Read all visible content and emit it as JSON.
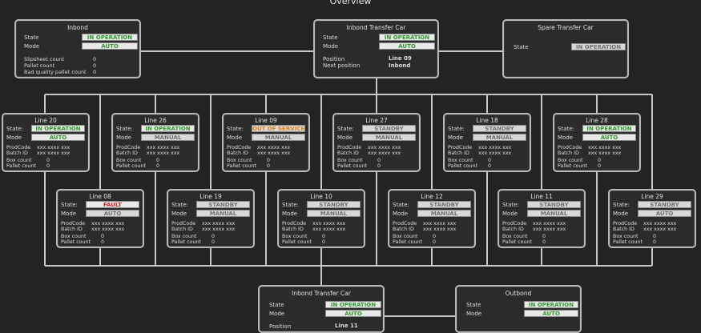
{
  "page_title": "Overview",
  "labels": {
    "state": "State",
    "state_colon": "State:",
    "mode": "Mode",
    "prodcode": "ProdCode",
    "batch_id": "Batch ID",
    "box_count": "Box count",
    "pallet_count": "Pallet count",
    "position": "Position",
    "next_position": "Next position",
    "slipsheet_count": "Slipsheet count",
    "bad_quality_pallet_count": "Bad quality pallet count"
  },
  "inbond": {
    "title": "Inbond",
    "state": "IN OPERATION",
    "mode": "AUTO",
    "slipsheet_count": "0",
    "pallet_count": "0",
    "bad_quality_pallet_count": "0"
  },
  "inbond_transfer_car_top": {
    "title": "Inbond Transfer Car",
    "state": "IN OPERATION",
    "mode": "AUTO",
    "position": "Line 09",
    "next_position": "Inbond"
  },
  "spare_transfer_car": {
    "title": "Spare Transfer Car",
    "state": "IN OPERATION"
  },
  "lines_row1": [
    {
      "title": "Line 20",
      "state": "IN OPERATION",
      "state_kind": "op",
      "mode": "AUTO",
      "mode_kind": "auto",
      "prodcode": "xxx xxxx xxx",
      "batch_id": "xxx xxxx xxx",
      "box_count": "0",
      "pallet_count": "0"
    },
    {
      "title": "Line 26",
      "state": "IN OPERATION",
      "state_kind": "op",
      "mode": "MANUAL",
      "mode_kind": "man",
      "prodcode": "xxx xxxx xxx",
      "batch_id": "xxx xxxx xxx",
      "box_count": "0",
      "pallet_count": "0"
    },
    {
      "title": "Line 09",
      "state": "OUT OF SERVICE",
      "state_kind": "oos",
      "mode": "MANUAL",
      "mode_kind": "man",
      "prodcode": "xxx xxxx xxx",
      "batch_id": "xxx xxxx xxx",
      "box_count": "0",
      "pallet_count": "0"
    },
    {
      "title": "Line 27",
      "state": "STANDBY",
      "state_kind": "stby",
      "mode": "MANUAL",
      "mode_kind": "man",
      "prodcode": "xxx xxxx xxx",
      "batch_id": "xxx xxxx xxx",
      "box_count": "0",
      "pallet_count": "0"
    },
    {
      "title": "Line 18",
      "state": "STANDBY",
      "state_kind": "stby",
      "mode": "MANUAL",
      "mode_kind": "man",
      "prodcode": "xxx xxxx xxx",
      "batch_id": "xxx xxxx xxx",
      "box_count": "0",
      "pallet_count": "0"
    },
    {
      "title": "Line 28",
      "state": "IN OPERATION",
      "state_kind": "op",
      "mode": "AUTO",
      "mode_kind": "auto",
      "prodcode": "xxx xxxx xxx",
      "batch_id": "xxx xxxx xxx",
      "box_count": "0",
      "pallet_count": "0"
    }
  ],
  "lines_row2": [
    {
      "title": "Line 08",
      "state": "FAULT",
      "state_kind": "fault",
      "mode": "AUTO",
      "mode_kind": "grey",
      "prodcode": "xxx xxxx xxx",
      "batch_id": "xxx xxxx xxx",
      "box_count": "0",
      "pallet_count": "0"
    },
    {
      "title": "Line 19",
      "state": "STANDBY",
      "state_kind": "stby",
      "mode": "MANUAL",
      "mode_kind": "man",
      "prodcode": "xxx xxxx xxx",
      "batch_id": "xxx xxxx xxx",
      "box_count": "0",
      "pallet_count": "0"
    },
    {
      "title": "Line 10",
      "state": "STANDBY",
      "state_kind": "stby",
      "mode": "MANUAL",
      "mode_kind": "man",
      "prodcode": "xxx xxxx xxx",
      "batch_id": "xxx xxxx xxx",
      "box_count": "0",
      "pallet_count": "0"
    },
    {
      "title": "Line 12",
      "state": "STANDBY",
      "state_kind": "stby",
      "mode": "MANUAL",
      "mode_kind": "man",
      "prodcode": "xxx xxxx xxx",
      "batch_id": "xxx xxxx xxx",
      "box_count": "0",
      "pallet_count": "0"
    },
    {
      "title": "Line 11",
      "state": "STANDBY",
      "state_kind": "stby",
      "mode": "MANUAL",
      "mode_kind": "man",
      "prodcode": "xxx xxxx xxx",
      "batch_id": "xxx xxxx xxx",
      "box_count": "0",
      "pallet_count": "0"
    },
    {
      "title": "Line 29",
      "state": "STANDBY",
      "state_kind": "stby",
      "mode": "AUTO",
      "mode_kind": "grey",
      "prodcode": "xxx xxxx xxx",
      "batch_id": "xxx xxxx xxx",
      "box_count": "0",
      "pallet_count": "0"
    }
  ],
  "inbond_transfer_car_bottom": {
    "title": "Inbond Transfer Car",
    "state": "IN OPERATION",
    "mode": "AUTO",
    "position": "Line 11"
  },
  "outbond": {
    "title": "Outbond",
    "state": "IN OPERATION",
    "mode": "AUTO"
  },
  "colors": {
    "background": "#232323",
    "panel_border": "#b9b9b9",
    "ok_green": "#2e9a2e",
    "fault_red": "#d02020",
    "out_of_service_orange": "#e08020",
    "line_color": "#c8c8c8"
  }
}
